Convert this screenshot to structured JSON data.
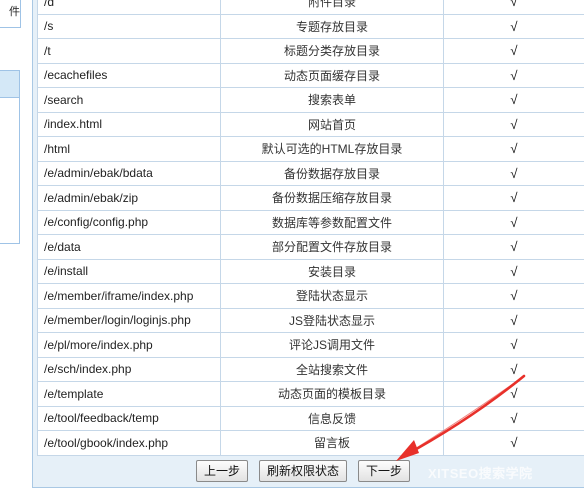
{
  "sidebar": {
    "top_label": "件"
  },
  "rows": [
    {
      "path": "/d",
      "desc": "附件目录",
      "status": "√"
    },
    {
      "path": "/s",
      "desc": "专题存放目录",
      "status": "√"
    },
    {
      "path": "/t",
      "desc": "标题分类存放目录",
      "status": "√"
    },
    {
      "path": "/ecachefiles",
      "desc": "动态页面缓存目录",
      "status": "√"
    },
    {
      "path": "/search",
      "desc": "搜索表单",
      "status": "√"
    },
    {
      "path": "/index.html",
      "desc": "网站首页",
      "status": "√"
    },
    {
      "path": "/html",
      "desc": "默认可选的HTML存放目录",
      "status": "√"
    },
    {
      "path": "/e/admin/ebak/bdata",
      "desc": "备份数据存放目录",
      "status": "√"
    },
    {
      "path": "/e/admin/ebak/zip",
      "desc": "备份数据压缩存放目录",
      "status": "√"
    },
    {
      "path": "/e/config/config.php",
      "desc": "数据库等参数配置文件",
      "status": "√"
    },
    {
      "path": "/e/data",
      "desc": "部分配置文件存放目录",
      "status": "√"
    },
    {
      "path": "/e/install",
      "desc": "安装目录",
      "status": "√"
    },
    {
      "path": "/e/member/iframe/index.php",
      "desc": "登陆状态显示",
      "status": "√"
    },
    {
      "path": "/e/member/login/loginjs.php",
      "desc": "JS登陆状态显示",
      "status": "√"
    },
    {
      "path": "/e/pl/more/index.php",
      "desc": "评论JS调用文件",
      "status": "√"
    },
    {
      "path": "/e/sch/index.php",
      "desc": "全站搜索文件",
      "status": "√"
    },
    {
      "path": "/e/template",
      "desc": "动态页面的模板目录",
      "status": "√"
    },
    {
      "path": "/e/tool/feedback/temp",
      "desc": "信息反馈",
      "status": "√"
    },
    {
      "path": "/e/tool/gbook/index.php",
      "desc": "留言板",
      "status": "√"
    }
  ],
  "buttons": {
    "prev": "上一步",
    "refresh": "刷新权限状态",
    "next": "下一步"
  },
  "watermark": "XITSEO搜索学院",
  "colors": {
    "frame_bg": "#e6f0f8",
    "border": "#c5d7e8",
    "arrow": "#e8302a"
  }
}
